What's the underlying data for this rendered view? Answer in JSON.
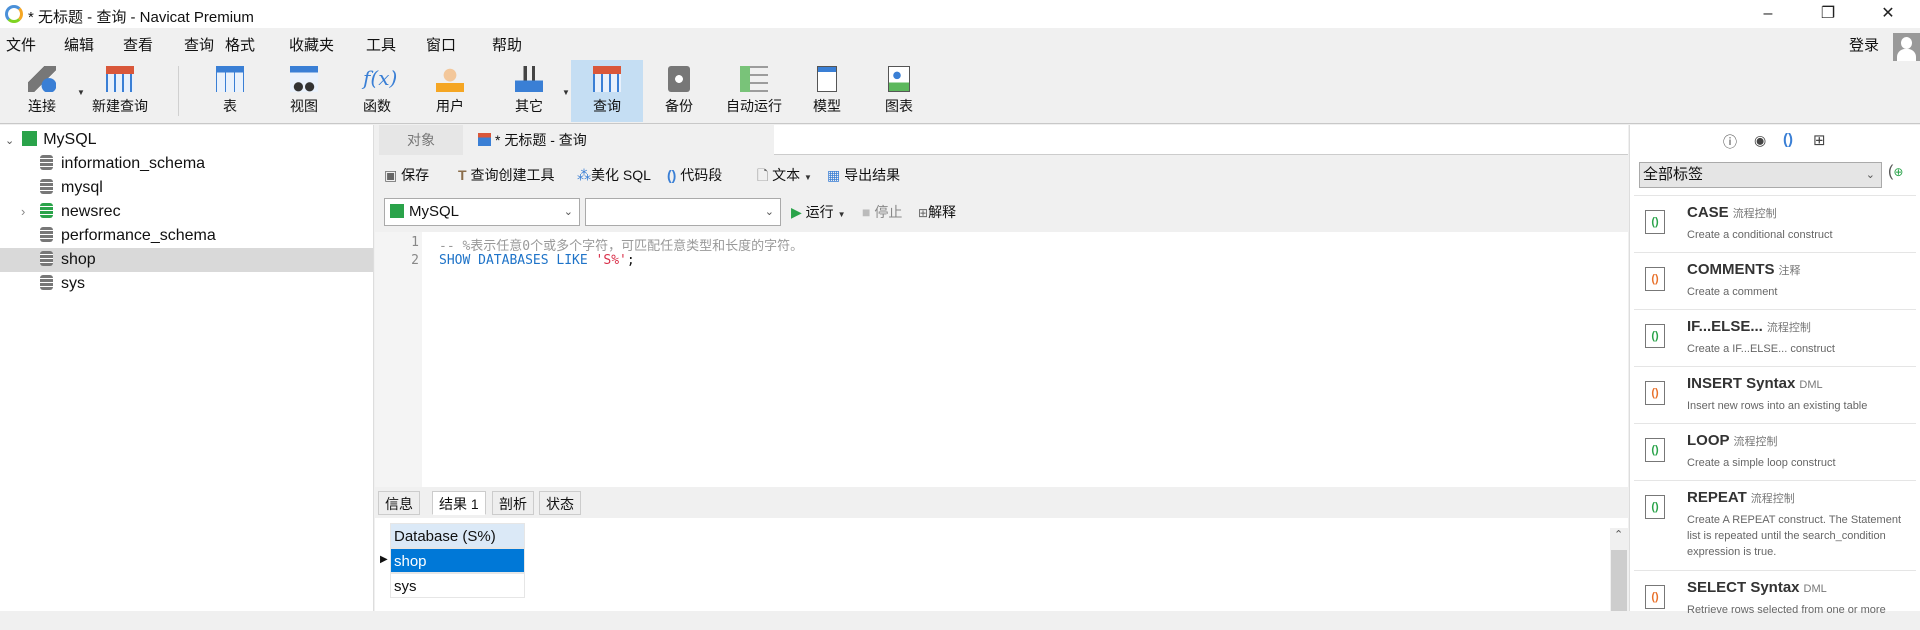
{
  "window": {
    "title": "* 无标题 - 查询 - Navicat Premium",
    "min": "–",
    "max": "❐",
    "close": "✕"
  },
  "menu": [
    "文件",
    "编辑",
    "查看",
    "查询",
    "格式",
    "收藏夹",
    "工具",
    "窗口",
    "帮助"
  ],
  "login": "登录",
  "toolbar": [
    {
      "label": "连接",
      "icon": "plug-icon"
    },
    {
      "label": "新建查询",
      "icon": "new-query-icon"
    },
    {
      "label": "表",
      "icon": "table-icon"
    },
    {
      "label": "视图",
      "icon": "view-icon"
    },
    {
      "label": "函数",
      "icon": "function-icon"
    },
    {
      "label": "用户",
      "icon": "user-icon"
    },
    {
      "label": "其它",
      "icon": "tools-icon"
    },
    {
      "label": "查询",
      "icon": "query-icon"
    },
    {
      "label": "备份",
      "icon": "backup-icon"
    },
    {
      "label": "自动运行",
      "icon": "schedule-icon"
    },
    {
      "label": "模型",
      "icon": "model-icon"
    },
    {
      "label": "图表",
      "icon": "chart-icon"
    }
  ],
  "tree": {
    "connection": "MySQL",
    "databases": [
      "information_schema",
      "mysql",
      "newsrec",
      "performance_schema",
      "shop",
      "sys"
    ],
    "selected": "shop"
  },
  "tabs": {
    "objects": "对象",
    "query": "* 无标题 - 查询"
  },
  "query_toolbar": {
    "save": "保存",
    "builder": "查询创建工具",
    "beautify": "美化 SQL",
    "snippet": "代码段",
    "text": "文本",
    "export": "导出结果"
  },
  "selectors": {
    "connection": "MySQL",
    "database": ""
  },
  "run": {
    "run": "运行",
    "stop": "停止",
    "explain": "解释"
  },
  "editor": {
    "lines": [
      {
        "n": "1",
        "text": "-- %表示任意0个或多个字符，可匹配任意类型和长度的字符。"
      },
      {
        "n": "2",
        "kw": "SHOW DATABASES LIKE ",
        "str": "'S%'",
        "end": ";"
      }
    ]
  },
  "result_tabs": [
    "信息",
    "结果 1",
    "剖析",
    "状态"
  ],
  "result": {
    "header": "Database (S%)",
    "rows": [
      "shop",
      "sys"
    ]
  },
  "snippets": {
    "filter": "全部标签",
    "items": [
      {
        "title": "CASE",
        "tag": "流程控制",
        "desc": "Create a conditional construct"
      },
      {
        "title": "COMMENTS",
        "tag": "注释",
        "desc": "Create a comment"
      },
      {
        "title": "IF...ELSE...",
        "tag": "流程控制",
        "desc": "Create a IF...ELSE... construct"
      },
      {
        "title": "INSERT Syntax",
        "tag": "DML",
        "desc": "Insert new rows into an existing table"
      },
      {
        "title": "LOOP",
        "tag": "流程控制",
        "desc": "Create a simple loop construct"
      },
      {
        "title": "REPEAT",
        "tag": "流程控制",
        "desc": "Create A REPEAT construct. The Statement list is repeated until the search_condition expression is true."
      },
      {
        "title": "SELECT Syntax",
        "tag": "DML",
        "desc": "Retrieve rows selected from one or more"
      }
    ]
  }
}
